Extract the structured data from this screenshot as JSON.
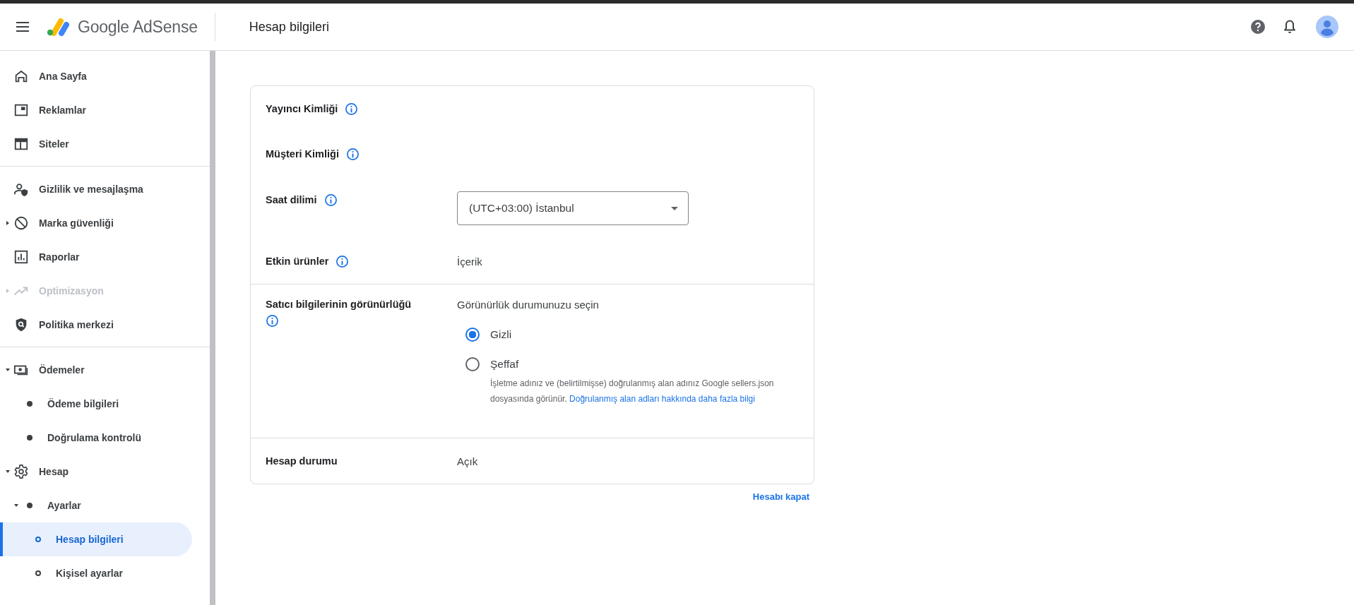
{
  "header": {
    "product": "Google AdSense",
    "page_title": "Hesap bilgileri"
  },
  "sidebar": {
    "sections": [
      [
        {
          "label": "Ana Sayfa",
          "selected": false,
          "disabled": false
        },
        {
          "label": "Reklamlar",
          "selected": false,
          "disabled": false
        },
        {
          "label": "Siteler",
          "selected": false,
          "disabled": false
        }
      ],
      [
        {
          "label": "Gizlilik ve mesajlaşma",
          "selected": false,
          "disabled": false
        },
        {
          "label": "Marka güvenliği",
          "selected": false,
          "disabled": false,
          "expanded": false
        },
        {
          "label": "Raporlar",
          "selected": false,
          "disabled": false
        },
        {
          "label": "Optimizasyon",
          "selected": false,
          "disabled": true,
          "expanded": false
        },
        {
          "label": "Politika merkezi",
          "selected": false,
          "disabled": false
        }
      ],
      [
        {
          "label": "Ödemeler",
          "selected": false,
          "disabled": false,
          "expanded": true,
          "children": [
            {
              "label": "Ödeme bilgileri",
              "selected": false,
              "disabled": false
            },
            {
              "label": "Doğrulama kontrolü",
              "selected": false,
              "disabled": false
            }
          ]
        },
        {
          "label": "Hesap",
          "selected": false,
          "disabled": false,
          "expanded": true,
          "children": [
            {
              "label": "Ayarlar",
              "selected": false,
              "disabled": false,
              "expanded": true,
              "children": [
                {
                  "label": "Hesap bilgileri",
                  "selected": true,
                  "disabled": false
                },
                {
                  "label": "Kişisel ayarlar",
                  "selected": false,
                  "disabled": false
                }
              ]
            }
          ]
        }
      ]
    ]
  },
  "card": {
    "sections": [
      [
        {
          "kind": "text",
          "label": "Yayıncı Kimliği",
          "info": true
        },
        {
          "kind": "text",
          "label": "Müşteri Kimliği",
          "info": true
        },
        {
          "kind": "select",
          "label": "Saat dilimi",
          "info": true,
          "value": "(UTC+03:00) İstanbul"
        },
        {
          "kind": "text",
          "label": "Etkin ürünler",
          "info": true,
          "value": "İçerik"
        }
      ],
      [
        {
          "kind": "radio",
          "label": "Satıcı bilgilerinin görünürlüğü",
          "info": true,
          "prompt": "Görünürlük durumunuzu seçin",
          "options": [
            {
              "label": "Gizli",
              "selected": true
            },
            {
              "label": "Şeffaf",
              "selected": false,
              "description": "İşletme adınız ve (belirtilmişse) doğrulanmış alan adınız Google sellers.json dosyasında görünür.",
              "link": "Doğrulanmış alan adları hakkında daha fazla bilgi"
            }
          ]
        }
      ],
      [
        {
          "kind": "text",
          "label": "Hesap durumu",
          "info": false,
          "value": "Açık"
        }
      ]
    ]
  },
  "footer_link": "Hesabı kapat"
}
